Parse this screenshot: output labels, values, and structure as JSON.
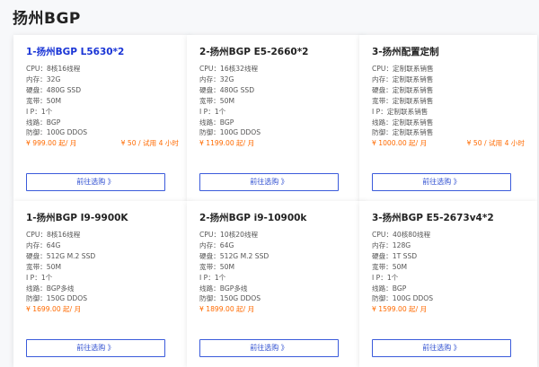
{
  "page": {
    "title": "扬州BGP"
  },
  "plans": [
    {
      "title": "1-扬州BGP L5630*2",
      "specs": [
        "CPU：8核16线程",
        "内存：32G",
        "硬盘：480G SSD",
        "宽带：50M",
        "I P：1个",
        "线路：BGP",
        "防御：100G DDOS"
      ],
      "price": "¥ 999.00 起/ 月",
      "trial": "¥ 50 / 试用 4 小时",
      "button": "前往选购 》"
    },
    {
      "title": "2-扬州BGP E5-2660*2",
      "specs": [
        "CPU：16核32线程",
        "内存：32G",
        "硬盘：480G SSD",
        "宽带：50M",
        "I P：1个",
        "线路：BGP",
        "防御：100G DDOS"
      ],
      "price": "¥ 1199.00 起/ 月",
      "trial": "",
      "button": "前往选购 》"
    },
    {
      "title": "3-扬州配置定制",
      "specs": [
        "CPU：定制联系销售",
        "内存：定制联系销售",
        "硬盘：定制联系销售",
        "宽带：定制联系销售",
        "I P：定制联系销售",
        "线路：定制联系销售",
        "防御：定制联系销售"
      ],
      "price": "¥ 1000.00 起/ 月",
      "trial": "¥ 50 / 试用 4 小时",
      "button": "前往选购 》"
    },
    {
      "title": "1-扬州BGP I9-9900K",
      "specs": [
        "CPU：8核16线程",
        "内存：64G",
        "硬盘：512G M.2 SSD",
        "宽带：50M",
        "I P：1个",
        "线路：BGP多线",
        "防御：150G DDOS"
      ],
      "price": "¥ 1699.00 起/ 月",
      "trial": "",
      "button": "前往选购 》"
    },
    {
      "title": "2-扬州BGP i9-10900k",
      "specs": [
        "CPU：10核20线程",
        "内存：64G",
        "硬盘：512G M.2 SSD",
        "宽带：50M",
        "I P：1个",
        "线路：BGP多线",
        "防御：150G DDOS"
      ],
      "price": "¥ 1899.00 起/ 月",
      "trial": "",
      "button": "前往选购 》"
    },
    {
      "title": "3-扬州BGP E5-2673v4*2",
      "specs": [
        "CPU：40核80线程",
        "内存：128G",
        "硬盘：1T SSD",
        "宽带：50M",
        "I P：1个",
        "线路：BGP",
        "防御：100G DDOS"
      ],
      "price": "¥ 1599.00 起/ 月",
      "trial": "",
      "button": "前往选购 》"
    }
  ],
  "colors": {
    "featured_title": "#1a35d6",
    "price": "#ff6a00",
    "button_border": "#3b5bdb"
  }
}
